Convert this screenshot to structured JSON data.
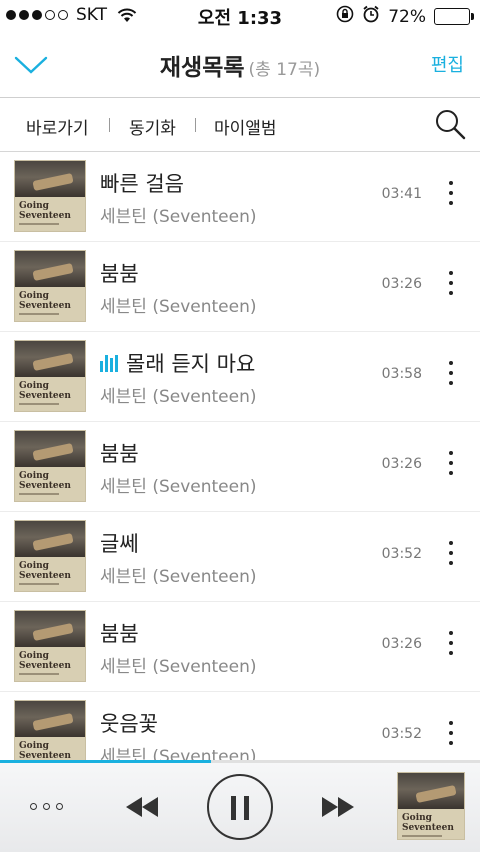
{
  "status": {
    "carrier": "SKT",
    "time": "오전 1:33",
    "battery": "72%",
    "battery_level": 72
  },
  "header": {
    "title": "재생목록",
    "count": "(총 17곡)",
    "edit": "편집",
    "accent_color": "#1ab0df"
  },
  "subnav": {
    "items": [
      "바로가기",
      "동기화",
      "마이앨범"
    ]
  },
  "album_art_text": "Going Seventeen",
  "tracks": [
    {
      "title": "빠른 걸음",
      "artist": "세븐틴 (Seventeen)",
      "duration": "03:41"
    },
    {
      "title": "붐붐",
      "artist": "세븐틴 (Seventeen)",
      "duration": "03:26"
    },
    {
      "title": "몰래 듣지 마요",
      "artist": "세븐틴 (Seventeen)",
      "duration": "03:58",
      "playing": true
    },
    {
      "title": "붐붐",
      "artist": "세븐틴 (Seventeen)",
      "duration": "03:26"
    },
    {
      "title": "글쎄",
      "artist": "세븐틴 (Seventeen)",
      "duration": "03:52"
    },
    {
      "title": "붐붐",
      "artist": "세븐틴 (Seventeen)",
      "duration": "03:26"
    },
    {
      "title": "웃음꽃",
      "artist": "세븐틴 (Seventeen)",
      "duration": "03:52"
    }
  ],
  "player": {
    "progress": 0.44,
    "icons": [
      "more-icon",
      "previous-icon",
      "pause-icon",
      "next-icon"
    ]
  }
}
